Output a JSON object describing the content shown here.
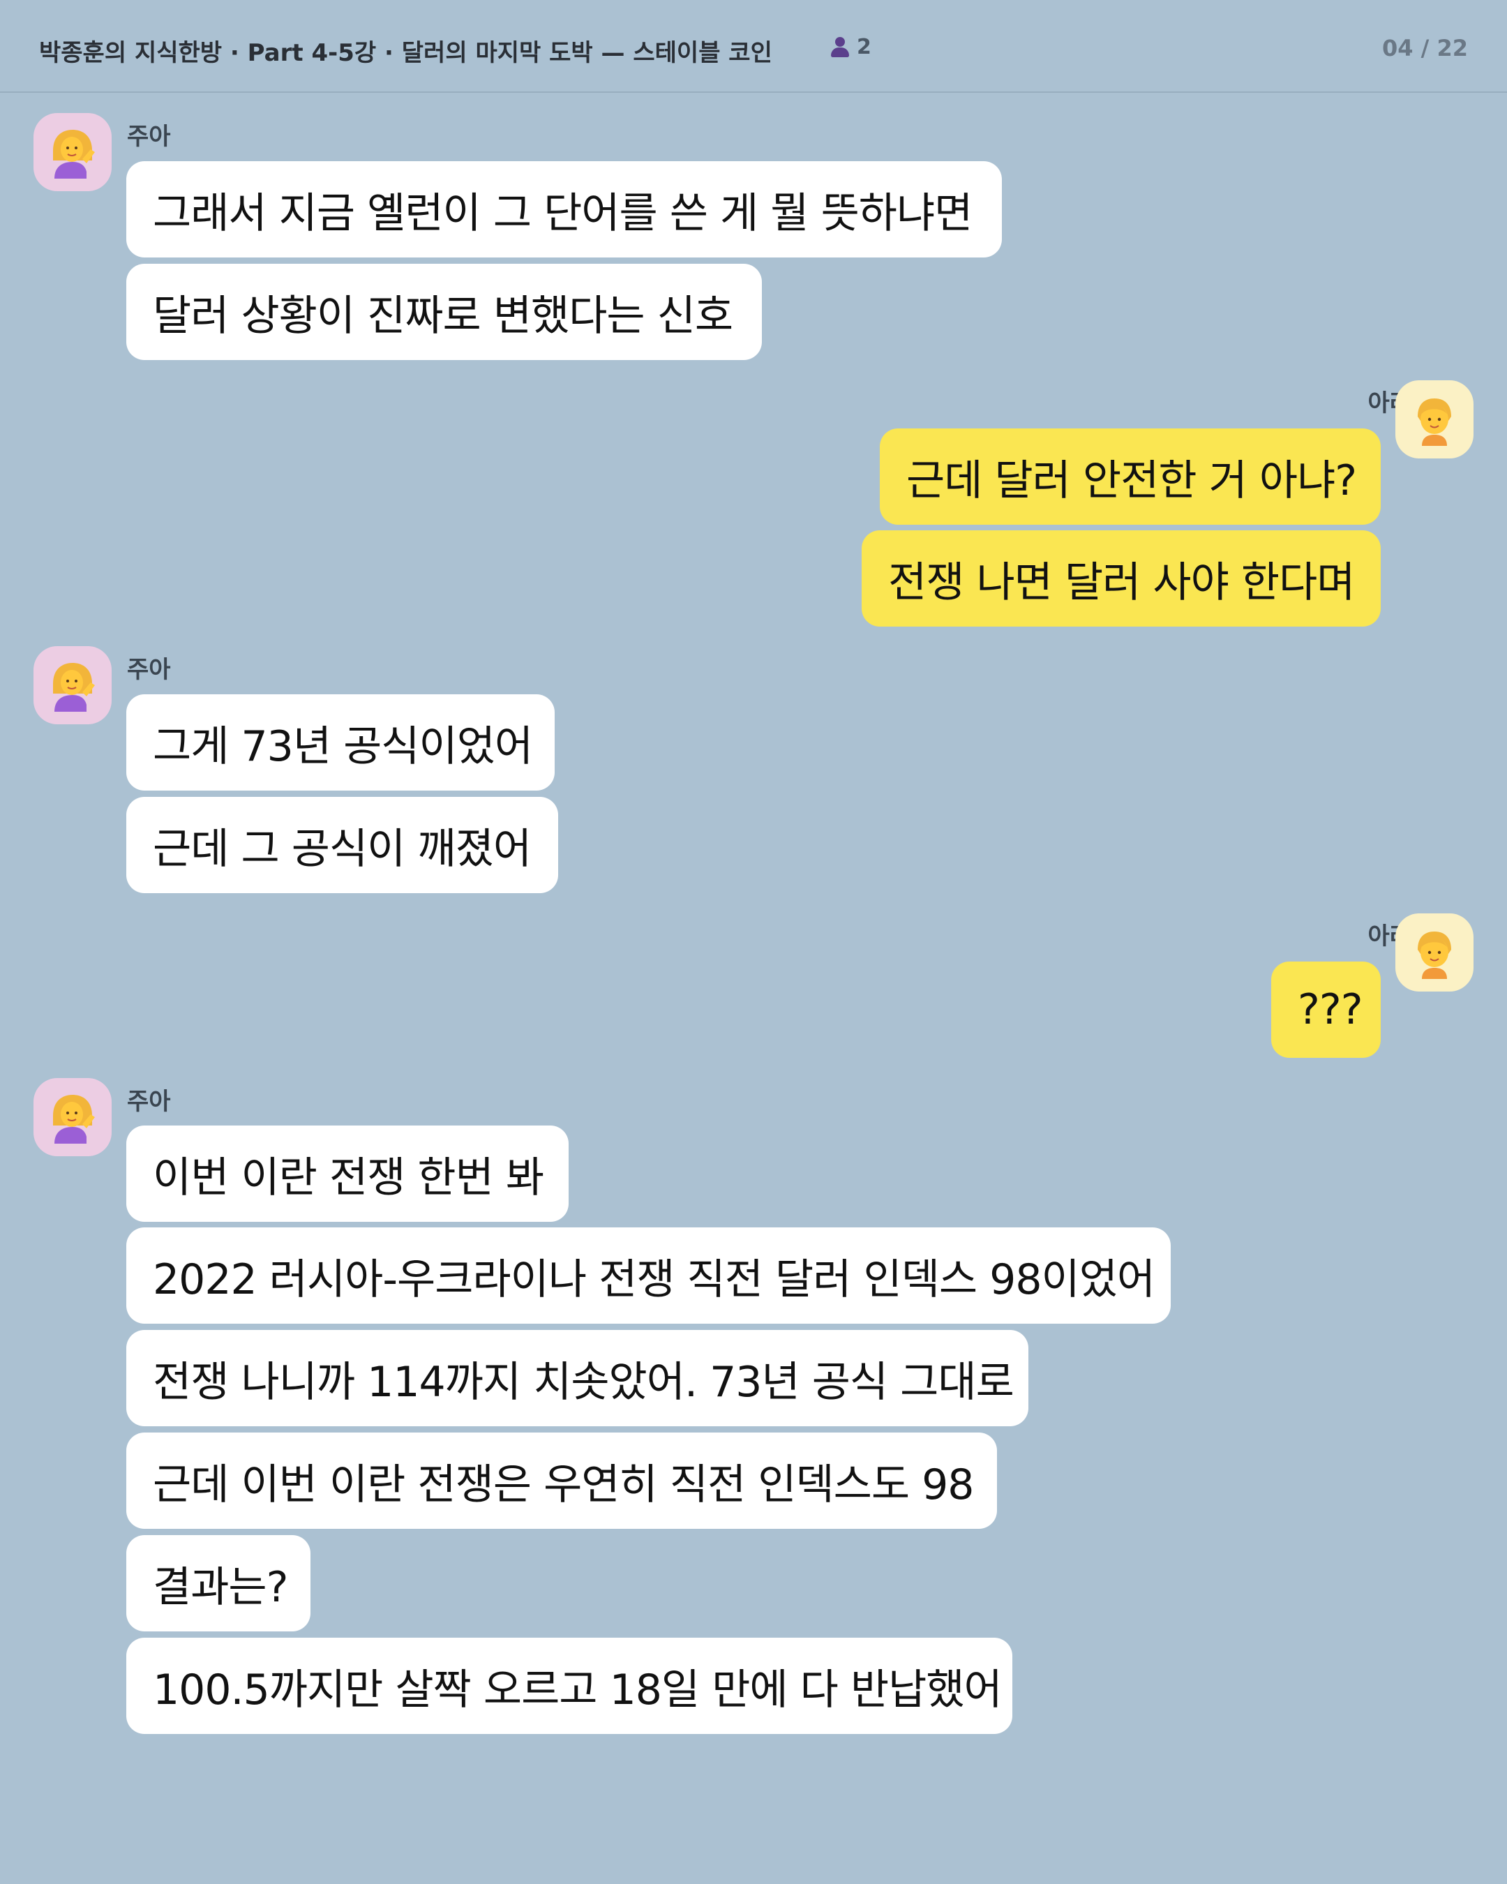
{
  "header": {
    "title": "박종훈의 지식한방 · Part 4-5강 · 달러의 마지막 도박 — 스테이블 코인",
    "participants": "2",
    "page": "04 / 22"
  },
  "senders": {
    "zua": "주아",
    "ara": "아라"
  },
  "messages": {
    "g1": [
      "그래서 지금 옐런이 그 단어를 쓴 게 뭘 뜻하냐면",
      "달러 상황이 진짜로 변했다는 신호"
    ],
    "g2": [
      "근데 달러 안전한 거 아냐?",
      "전쟁 나면 달러 사야 한다며"
    ],
    "g3": [
      "그게 73년 공식이었어",
      "근데 그 공식이 깨졌어"
    ],
    "g4": [
      "???"
    ],
    "g5": [
      "이번 이란 전쟁 한번 봐",
      "2022 러시아-우크라이나 전쟁 직전 달러 인덱스 98이었어",
      "전쟁 나니까 114까지 치솟았어. 73년 공식 그대로",
      "근데 이번 이란 전쟁은 우연히 직전 인덱스도 98",
      "결과는?",
      "100.5까지만 살짝 오르고 18일 만에 다 반납했어"
    ]
  }
}
